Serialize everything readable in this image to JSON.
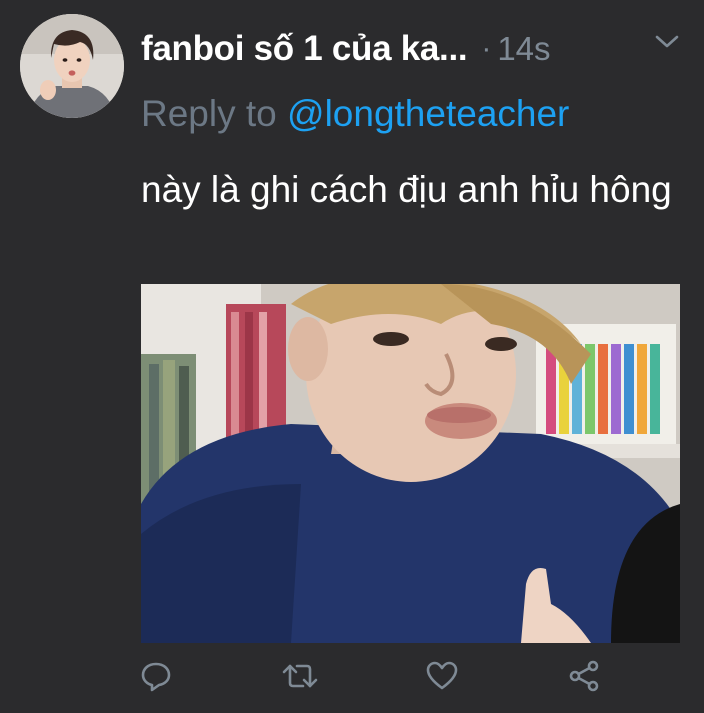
{
  "tweet": {
    "display_name": "fanboi số 1 của ka...",
    "separator": "·",
    "timestamp": "14s",
    "reply_prefix": "Reply to",
    "reply_handle": "@longtheteacher",
    "text": "này là ghi cách địu anh hỉu hông"
  },
  "icons": {
    "caret": "chevron-down-icon",
    "reply": "reply-icon",
    "retweet": "retweet-icon",
    "like": "heart-icon",
    "share": "share-icon"
  },
  "colors": {
    "background": "#2b2b2d",
    "text": "#ffffff",
    "muted": "#7f8a95",
    "link": "#1da1f2"
  }
}
